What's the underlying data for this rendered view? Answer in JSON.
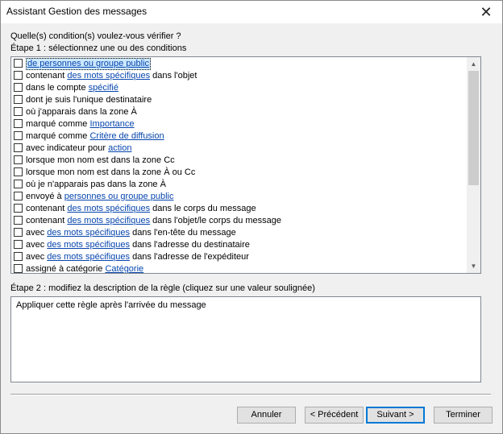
{
  "window": {
    "title": "Assistant Gestion des messages",
    "close_icon": "close-icon"
  },
  "prompt": "Quelle(s) condition(s) voulez-vous vérifier ?",
  "step1_label": "Étape 1 : sélectionnez une ou des conditions",
  "conditions": [
    {
      "pre": "",
      "link": "de personnes ou groupe public",
      "post": "",
      "checked": false,
      "selected": true
    },
    {
      "pre": "contenant ",
      "link": "des mots spécifiques",
      "post": " dans l'objet",
      "checked": false,
      "selected": false
    },
    {
      "pre": "dans le compte ",
      "link": "spécifié",
      "post": "",
      "checked": false,
      "selected": false
    },
    {
      "pre": "dont je suis l'unique destinataire",
      "link": "",
      "post": "",
      "checked": false,
      "selected": false
    },
    {
      "pre": "où j'apparais dans la zone À",
      "link": "",
      "post": "",
      "checked": false,
      "selected": false
    },
    {
      "pre": "marqué comme ",
      "link": "Importance",
      "post": "",
      "checked": false,
      "selected": false
    },
    {
      "pre": "marqué comme ",
      "link": "Critère de diffusion",
      "post": "",
      "checked": false,
      "selected": false
    },
    {
      "pre": "avec indicateur pour ",
      "link": "action ",
      "post": "",
      "checked": false,
      "selected": false
    },
    {
      "pre": "lorsque mon nom est dans la zone Cc",
      "link": "",
      "post": "",
      "checked": false,
      "selected": false
    },
    {
      "pre": "lorsque mon nom est dans la zone À ou Cc",
      "link": "",
      "post": "",
      "checked": false,
      "selected": false
    },
    {
      "pre": "où je n'apparais pas dans la zone À",
      "link": "",
      "post": "",
      "checked": false,
      "selected": false
    },
    {
      "pre": "envoyé à ",
      "link": "personnes ou groupe public",
      "post": "",
      "checked": false,
      "selected": false
    },
    {
      "pre": "contenant ",
      "link": "des mots spécifiques",
      "post": " dans le corps du message",
      "checked": false,
      "selected": false
    },
    {
      "pre": "contenant ",
      "link": "des mots spécifiques",
      "post": " dans l'objet/le corps du message",
      "checked": false,
      "selected": false
    },
    {
      "pre": "avec ",
      "link": "des mots spécifiques",
      "post": " dans l'en-tête du message",
      "checked": false,
      "selected": false
    },
    {
      "pre": "avec ",
      "link": "des mots spécifiques",
      "post": " dans l'adresse du destinataire",
      "checked": false,
      "selected": false
    },
    {
      "pre": "avec ",
      "link": "des mots spécifiques",
      "post": " dans l'adresse de l'expéditeur",
      "checked": false,
      "selected": false
    },
    {
      "pre": "assigné à catégorie ",
      "link": "Catégorie",
      "post": "",
      "checked": false,
      "selected": false
    }
  ],
  "step2_label": "Étape 2 : modifiez la description de la règle (cliquez sur une valeur soulignée)",
  "description": "Appliquer cette règle après l'arrivée du message",
  "buttons": {
    "cancel": "Annuler",
    "previous": "< Précédent",
    "next": "Suivant >",
    "finish": "Terminer"
  },
  "colors": {
    "link": "#0645ad",
    "default_button_border": "#0078d7",
    "selection": "#cce8ff"
  }
}
